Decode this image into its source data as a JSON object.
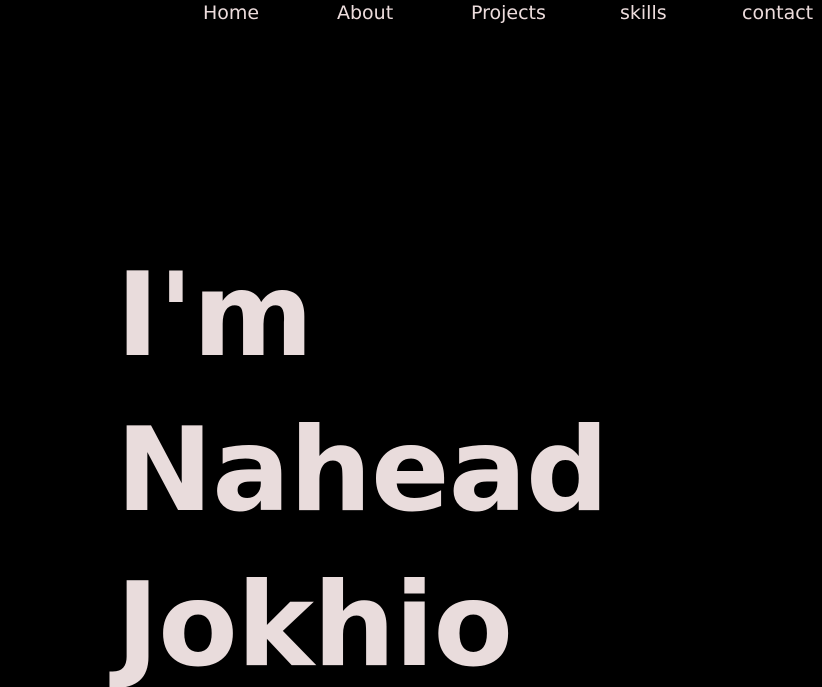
{
  "nav": {
    "items": [
      {
        "label": "Home"
      },
      {
        "label": "About"
      },
      {
        "label": "Projects"
      },
      {
        "label": "skills"
      },
      {
        "label": "contact"
      }
    ]
  },
  "hero": {
    "lines": [
      "I'm",
      "Nahead",
      "Jokhio"
    ]
  },
  "colors": {
    "background": "#000000",
    "text": "#e9dcdc"
  }
}
